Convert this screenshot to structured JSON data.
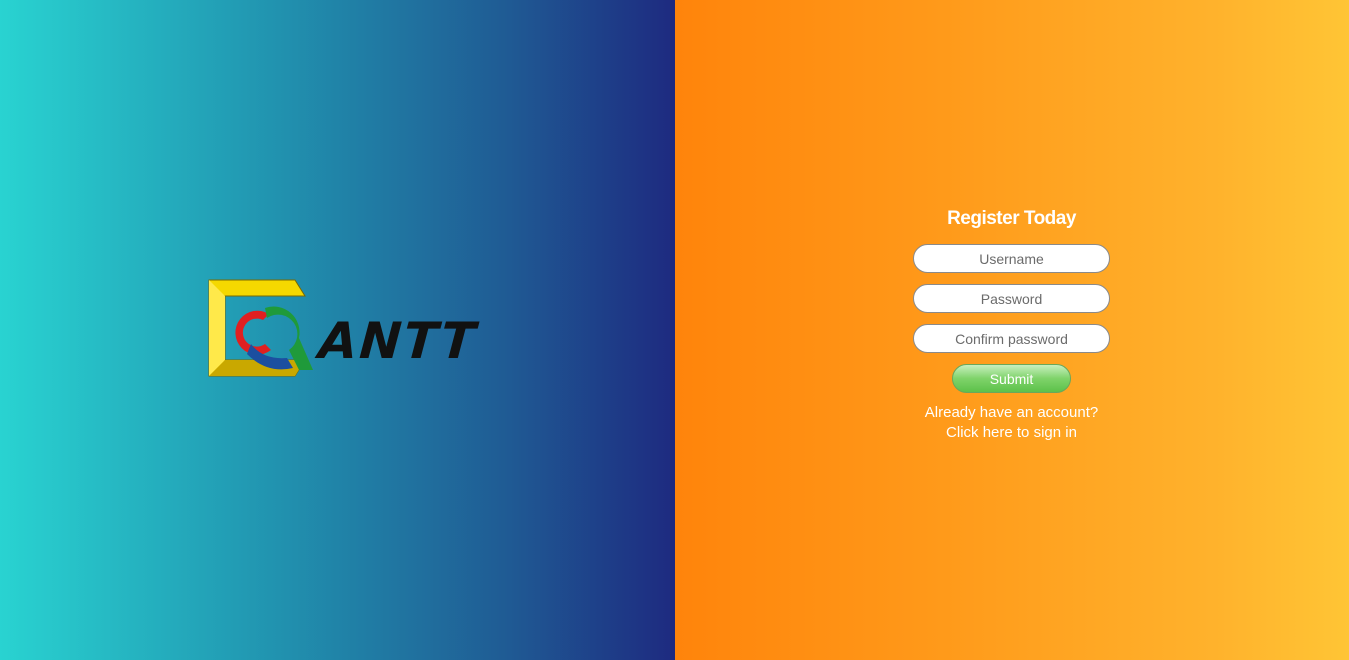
{
  "logo": {
    "text": "ANTT",
    "icon": "gantt-logo-icon",
    "colors": {
      "frame": "#f5d800",
      "red": "#e02020",
      "green": "#1f9a3a",
      "blue": "#1c4fa0"
    }
  },
  "form": {
    "title": "Register Today",
    "username_placeholder": "Username",
    "password_placeholder": "Password",
    "confirm_placeholder": "Confirm password",
    "submit_label": "Submit",
    "account_prompt": "Already have an account?",
    "signin_link": "Click here to sign in"
  },
  "colors": {
    "left_gradient_start": "#29d3d1",
    "left_gradient_end": "#1e2a80",
    "right_gradient_start": "#ff840b",
    "right_gradient_end": "#ffc535",
    "submit_green": "#5cc14a"
  }
}
